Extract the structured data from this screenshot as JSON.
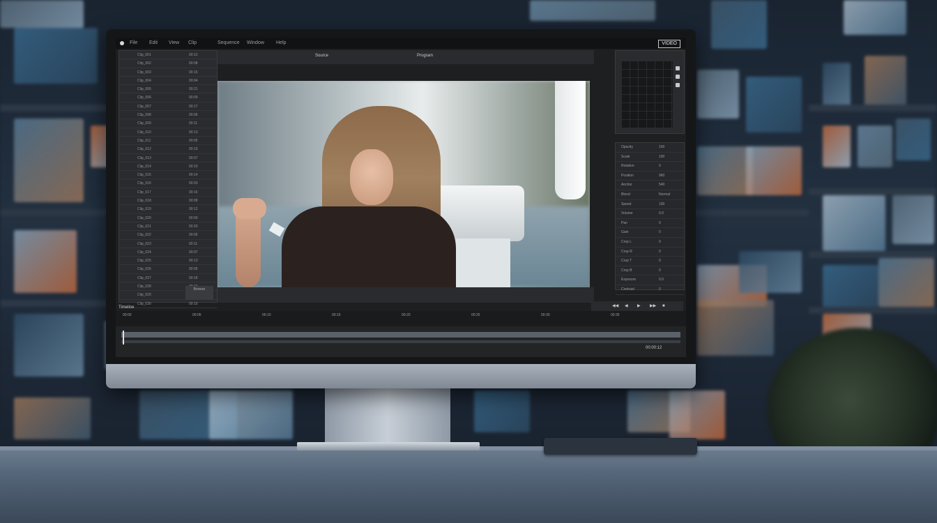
{
  "scene": {
    "description_colors": {
      "desk": "#5f6f82",
      "wall": "#1b2530",
      "screen_bg": "#1e1f21"
    }
  },
  "editor": {
    "menubar": {
      "items": [
        "File",
        "Edit",
        "View",
        "Clip",
        "Sequence",
        "Window",
        "Help"
      ],
      "brand": "VIDEO"
    },
    "viewer": {
      "title_left": "Source",
      "title_right": "Program"
    },
    "media_rows": [
      {
        "name": "Clip_001",
        "dur": "00:12"
      },
      {
        "name": "Clip_002",
        "dur": "00:08"
      },
      {
        "name": "Clip_003",
        "dur": "00:15"
      },
      {
        "name": "Clip_004",
        "dur": "00:04"
      },
      {
        "name": "Clip_005",
        "dur": "00:21"
      },
      {
        "name": "Clip_006",
        "dur": "00:09"
      },
      {
        "name": "Clip_007",
        "dur": "00:17"
      },
      {
        "name": "Clip_008",
        "dur": "00:06"
      },
      {
        "name": "Clip_009",
        "dur": "00:11"
      },
      {
        "name": "Clip_010",
        "dur": "00:13"
      },
      {
        "name": "Clip_011",
        "dur": "00:05"
      },
      {
        "name": "Clip_012",
        "dur": "00:19"
      },
      {
        "name": "Clip_013",
        "dur": "00:07"
      },
      {
        "name": "Clip_014",
        "dur": "00:10"
      },
      {
        "name": "Clip_015",
        "dur": "00:14"
      },
      {
        "name": "Clip_016",
        "dur": "00:03"
      },
      {
        "name": "Clip_017",
        "dur": "00:16"
      },
      {
        "name": "Clip_018",
        "dur": "00:08"
      },
      {
        "name": "Clip_019",
        "dur": "00:12"
      },
      {
        "name": "Clip_020",
        "dur": "00:09"
      },
      {
        "name": "Clip_021",
        "dur": "00:20"
      },
      {
        "name": "Clip_022",
        "dur": "00:06"
      },
      {
        "name": "Clip_023",
        "dur": "00:11"
      },
      {
        "name": "Clip_024",
        "dur": "00:07"
      },
      {
        "name": "Clip_025",
        "dur": "00:13"
      },
      {
        "name": "Clip_026",
        "dur": "00:05"
      },
      {
        "name": "Clip_027",
        "dur": "00:18"
      },
      {
        "name": "Clip_028",
        "dur": "00:10"
      },
      {
        "name": "Clip_029",
        "dur": "00:04"
      },
      {
        "name": "Clip_030",
        "dur": "00:15"
      }
    ],
    "left_footer": "Browse",
    "properties": [
      {
        "k": "Opacity",
        "v": "100"
      },
      {
        "k": "Scale",
        "v": "100"
      },
      {
        "k": "Rotation",
        "v": "0"
      },
      {
        "k": "Position",
        "v": "960"
      },
      {
        "k": "Anchor",
        "v": "540"
      },
      {
        "k": "Blend",
        "v": "Normal"
      },
      {
        "k": "Speed",
        "v": "100"
      },
      {
        "k": "Volume",
        "v": "0.0"
      },
      {
        "k": "Pan",
        "v": "0"
      },
      {
        "k": "Gain",
        "v": "0"
      },
      {
        "k": "Crop L",
        "v": "0"
      },
      {
        "k": "Crop R",
        "v": "0"
      },
      {
        "k": "Crop T",
        "v": "0"
      },
      {
        "k": "Crop B",
        "v": "0"
      },
      {
        "k": "Exposure",
        "v": "0.0"
      },
      {
        "k": "Contrast",
        "v": "0"
      }
    ],
    "controls": [
      "◀◀",
      "◀",
      "▶",
      "▶▶",
      "■"
    ],
    "timeline_label": "Timeline",
    "ruler": [
      "00:00",
      "00:05",
      "00:10",
      "00:15",
      "00:20",
      "00:25",
      "00:30",
      "00:35"
    ],
    "timecode": "00:00:12"
  }
}
